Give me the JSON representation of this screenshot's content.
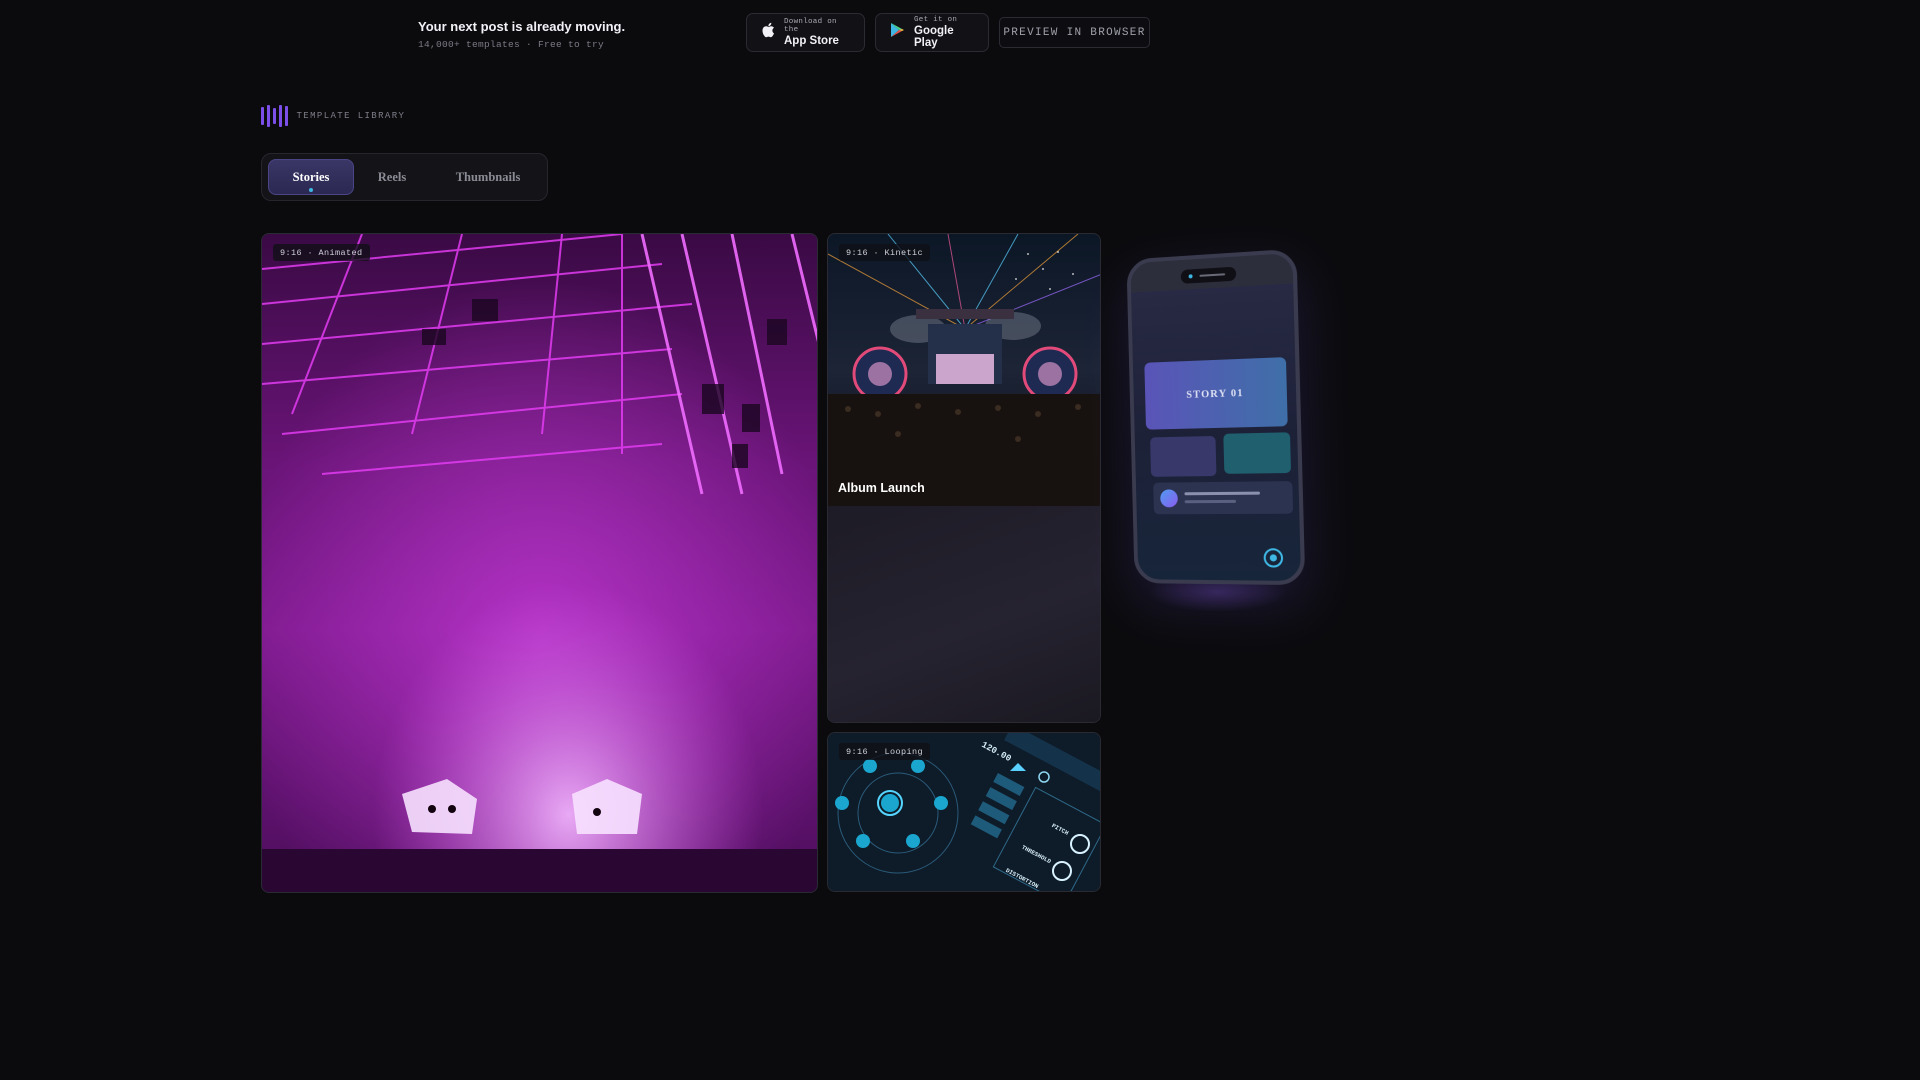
{
  "promo": {
    "headline": "Your next post is already moving.",
    "sub": "14,000+ templates · Free to try"
  },
  "stores": {
    "appstore": {
      "small": "Download on the",
      "big": "App Store",
      "icon": "apple-icon"
    },
    "play": {
      "small": "Get it on",
      "big": "Google Play",
      "icon": "google-play-icon"
    }
  },
  "preview_label": "PREVIEW IN BROWSER",
  "library": {
    "label": "TEMPLATE LIBRARY",
    "accent": "#7b4fe8"
  },
  "tabs": [
    {
      "label": "Stories",
      "active": true
    },
    {
      "label": "Reels",
      "active": false
    },
    {
      "label": "Thumbnails",
      "active": false
    }
  ],
  "cards": {
    "big": {
      "badge": "9:16 · Animated"
    },
    "kinetic": {
      "badge": "9:16 · Kinetic",
      "title": "Album Launch"
    },
    "loop": {
      "badge": "9:16 · Looping",
      "tempo": "120.00",
      "pitch_label": "PITCH",
      "threshold_label": "THRESHOLD",
      "distortion_label": "DISTORTION"
    }
  },
  "phone": {
    "story_label": "STORY 01"
  },
  "colors": {
    "accent_purple": "#7b4fe8",
    "accent_cyan": "#3fb7e4",
    "bg": "#0b0b0e"
  }
}
